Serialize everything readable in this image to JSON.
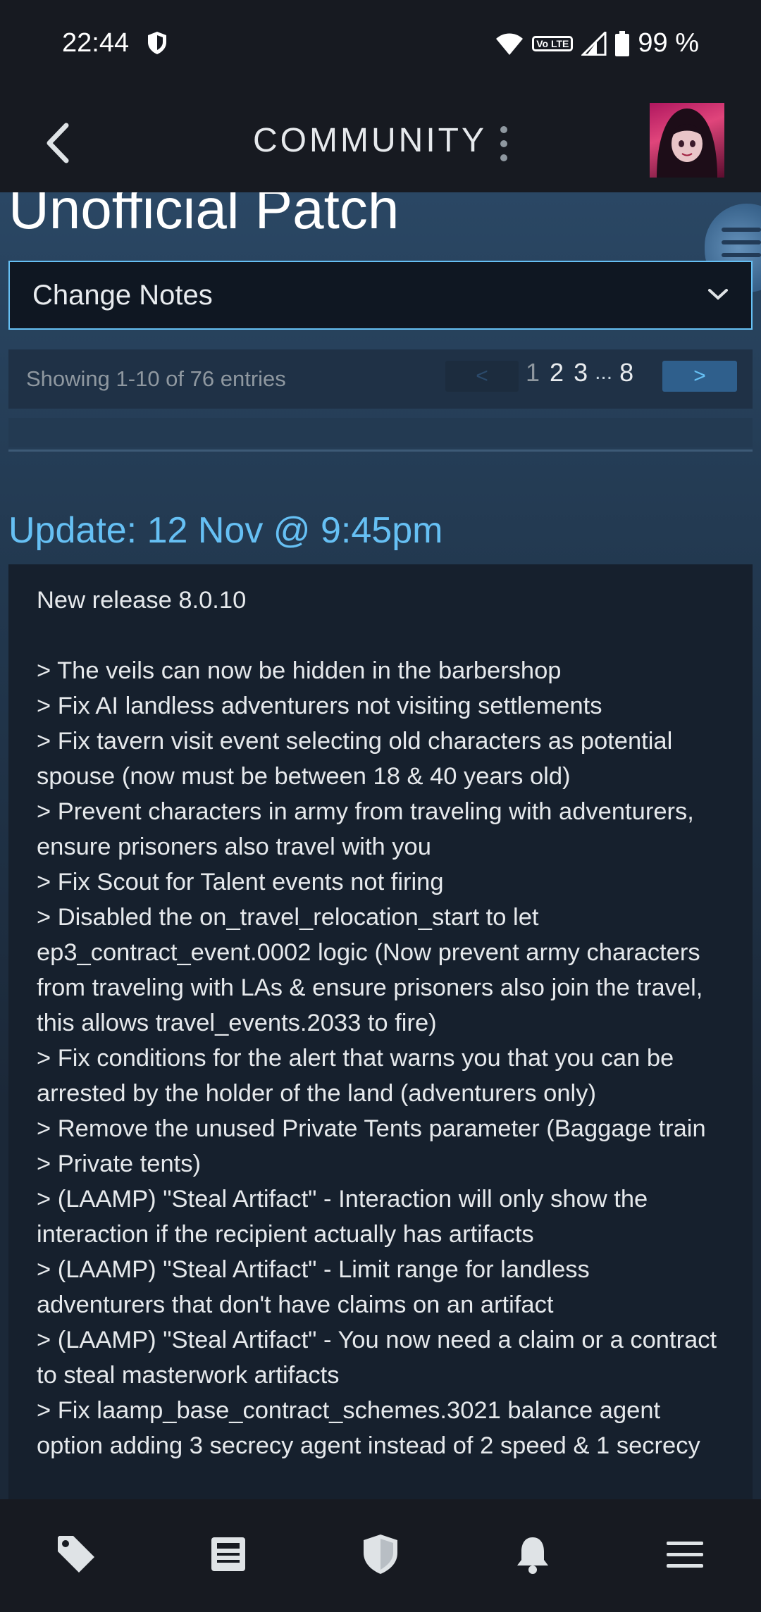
{
  "status_bar": {
    "time": "22:44",
    "volte": "Vo LTE",
    "battery": "99 %"
  },
  "header": {
    "title": "COMMUNITY"
  },
  "page": {
    "title": "Unofficial Patch",
    "dropdown_selected": "Change Notes"
  },
  "pager": {
    "info": "Showing 1-10 of 76 entries",
    "prev": "<",
    "pages": [
      "1",
      "2",
      "3",
      "...",
      "8"
    ],
    "next": ">"
  },
  "update": {
    "header": "Update: 12 Nov @ 9:45pm",
    "release": "New release 8.0.10",
    "lines": [
      "> The veils can now be hidden in the barbershop",
      "> Fix AI landless adventurers not visiting settlements",
      "> Fix tavern visit event selecting old characters as potential spouse (now must be between 18 & 40 years old)",
      "> Prevent characters in army from traveling with adventurers, ensure prisoners also travel with you",
      "> Fix Scout for Talent events not firing",
      "> Disabled the on_travel_relocation_start to let ep3_contract_event.0002 logic (Now prevent army characters from traveling with LAs & ensure prisoners also join the travel, this allows travel_events.2033 to fire)",
      "> Fix conditions for the alert that warns you that you can be arrested by the holder of the land (adventurers only)",
      "> Remove the unused Private Tents parameter (Baggage train > Private tents)",
      "> (LAAMP) \"Steal Artifact\" - Interaction will only show the interaction if the recipient actually has artifacts",
      "> (LAAMP) \"Steal Artifact\" - Limit range for landless adventurers that don't have claims on an artifact",
      "> (LAAMP) \"Steal Artifact\" - You now need a claim or a contract to steal masterwork artifacts",
      "> Fix laamp_base_contract_schemes.3021 balance agent option adding 3 secrecy agent instead of 2 speed & 1 secrecy"
    ]
  },
  "bottom_nav": {
    "icons": [
      "tag-icon",
      "news-icon",
      "shield-icon",
      "bell-icon",
      "menu-icon"
    ]
  },
  "colors": {
    "accent": "#66c0f4",
    "background": "#1b2838",
    "bar": "#171a21"
  }
}
